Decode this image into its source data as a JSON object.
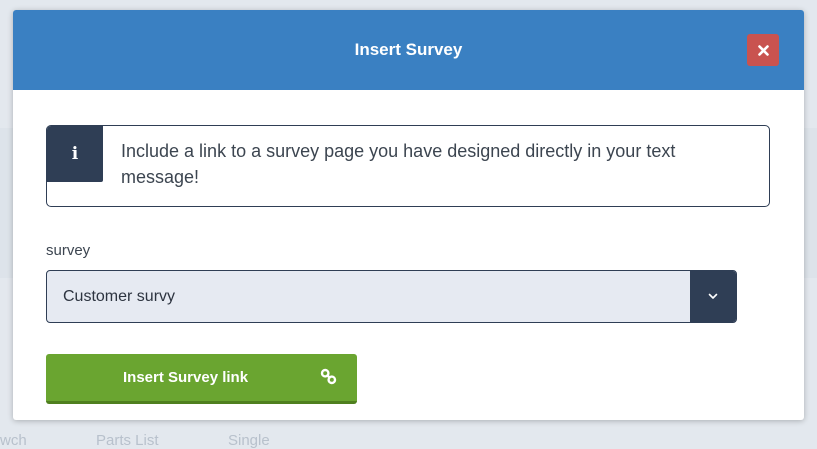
{
  "background": {
    "partial_texts": [
      "wch",
      "Parts List",
      "Single"
    ]
  },
  "modal": {
    "title": "Insert Survey",
    "close_icon": "close-x-icon",
    "info": {
      "icon": "info-icon",
      "glyph": "i",
      "text": "Include a link to a survey page you have designed directly in your text message!"
    },
    "survey_field": {
      "label": "survey",
      "selected_value": "Customer survy",
      "arrow_icon": "chevron-down-icon"
    },
    "insert_button": {
      "label": "Insert Survey link",
      "icon": "link-icon"
    }
  },
  "colors": {
    "header": "#3a80c2",
    "close": "#c9534f",
    "dark_navy": "#2f3e55",
    "select_bg": "#e6eaf2",
    "button_green": "#6aa530"
  }
}
